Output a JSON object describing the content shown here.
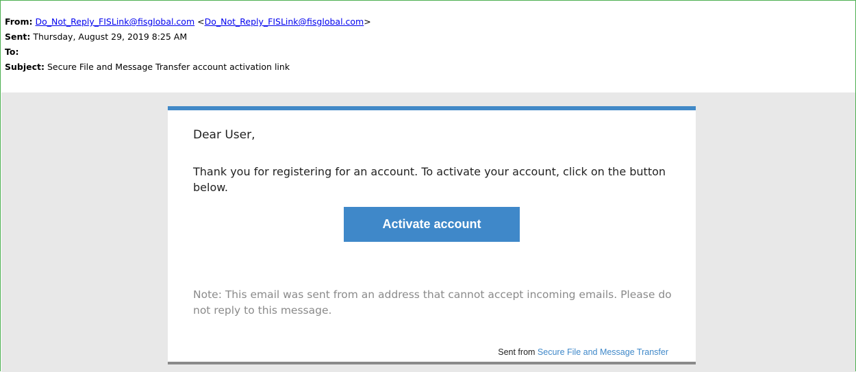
{
  "header": {
    "from_label": "From:",
    "from_link": "Do_Not_Reply_FISLink@fisglobal.com",
    "from_bracket_open": " <",
    "from_link_2": "Do_Not_Reply_FISLink@fisglobal.com",
    "from_bracket_close": ">",
    "sent_label": "Sent:",
    "sent_value": " Thursday, August 29, 2019 8:25 AM",
    "to_label": "To:",
    "subject_label": "Subject:",
    "subject_value": " Secure File and Message Transfer account activation link"
  },
  "message": {
    "greeting": "Dear User,",
    "body": "Thank you for registering for an account. To activate your account, click on the button below.",
    "button_label": "Activate account",
    "note": "Note: This email was sent from an address that cannot accept incoming emails. Please do not reply to this message.",
    "footer_prefix": "Sent from ",
    "footer_link": "Secure File and Message Transfer"
  },
  "colors": {
    "frame_border": "#4caf50",
    "accent_blue": "#3f88c9",
    "background_gray": "#e8e8e8",
    "note_gray": "#8a8a8a"
  }
}
